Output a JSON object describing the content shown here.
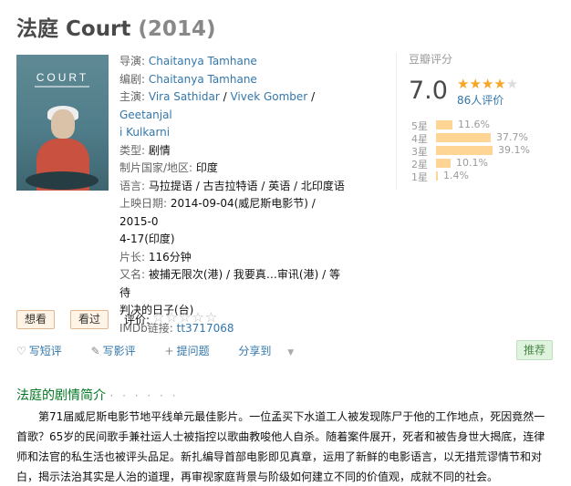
{
  "header": {
    "title": "法庭 Court",
    "year": "(2014)"
  },
  "poster": {
    "title": "COURT"
  },
  "info": {
    "director_label": "导演:",
    "director": "Chaitanya Tamhane",
    "writer_label": "编剧:",
    "writer": "Chaitanya Tamhane",
    "cast_label": "主演:",
    "cast": [
      "Vira Sathidar",
      "Vivek Gomber",
      "Geetanjal",
      "i Kulkarni"
    ],
    "genre_label": "类型:",
    "genre": "剧情",
    "country_label": "制片国家/地区:",
    "country": "印度",
    "language_label": "语言:",
    "language": "马拉提语 / 古吉拉特语 / 英语 / 北印度语",
    "release_label": "上映日期:",
    "release_1": "2014-09-04(威尼斯电影节) / 2015-0",
    "release_2": "4-17(印度)",
    "runtime_label": "片长:",
    "runtime": "116分钟",
    "aka_label": "又名:",
    "aka_1": "被捕无限次(港) / 我要真…审讯(港) / 等待",
    "aka_2": "判决的日子(台)",
    "imdb_label": "IMDb链接:",
    "imdb": "tt3717068"
  },
  "rating": {
    "label": "豆瓣评分",
    "score": "7.0",
    "stars_filled": 3.5,
    "votes": "86人评价",
    "distribution": [
      {
        "label": "5星",
        "percent": 11.6,
        "text": "11.6%"
      },
      {
        "label": "4星",
        "percent": 37.7,
        "text": "37.7%"
      },
      {
        "label": "3星",
        "percent": 39.1,
        "text": "39.1%"
      },
      {
        "label": "2星",
        "percent": 10.1,
        "text": "10.1%"
      },
      {
        "label": "1星",
        "percent": 1.4,
        "text": "1.4%"
      }
    ]
  },
  "interest": {
    "want": "想看",
    "seen": "看过",
    "rate_label": "评价:",
    "rate_stars": "☆☆☆☆☆"
  },
  "actions": {
    "short_review": "写短评",
    "review": "写影评",
    "question": "提问题",
    "share": "分享到",
    "recommend": "推荐"
  },
  "summary": {
    "title": "法庭的剧情简介",
    "dots": "· · · · · ·",
    "text": "第71届威尼斯电影节地平线单元最佳影片。一位孟买下水道工人被发现陈尸于他的工作地点，死因竟然一首歌？65岁的民间歌手兼社运人士被指控以歌曲教唆他人自杀。随着案件展开，死者和被告身世大揭底，连律师和法官的私生活也被评头品足。新扎编导首部电影即见真章，运用了新鲜的电影语言，以无措荒谬情节和对白，揭示法治其实是人治的道理，再审视家庭背景与阶级如何建立不同的价值观，成就不同的社会。"
  },
  "colors": {
    "link": "#3377aa",
    "bar": "#ffd596",
    "section": "#007722",
    "star": "#f5a623"
  }
}
